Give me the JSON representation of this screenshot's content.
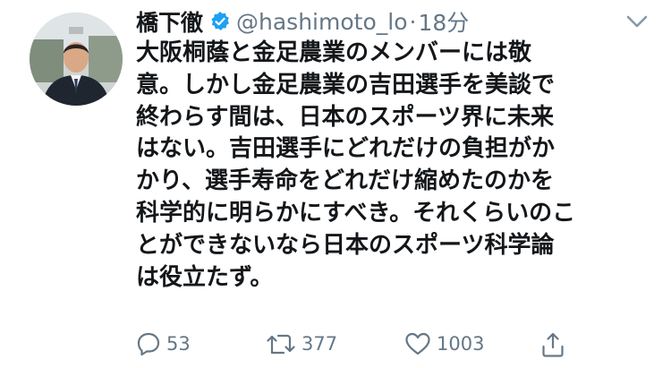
{
  "tweet": {
    "display_name": "橋下徹",
    "handle": "@hashimoto_lo",
    "separator": "·",
    "timestamp": "18分",
    "body_lines": [
      "大阪桐蔭と金足農業のメンバーには敬",
      "意。しかし金足農業の吉田選手を美談で",
      "終わらす間は、日本のスポーツ界に未来",
      "はない。吉田選手にどれだけの負担がか",
      "かり、選手寿命をどれだけ縮めたのかを",
      "科学的に明らかにすべき。それくらいのこ",
      "とができないなら日本のスポーツ科学論",
      "は役立たず。"
    ]
  },
  "actions": {
    "reply": {
      "icon": "reply-icon",
      "count": "53"
    },
    "retweet": {
      "icon": "retweet-icon",
      "count": "377"
    },
    "like": {
      "icon": "heart-icon",
      "count": "1003"
    },
    "share": {
      "icon": "share-icon"
    }
  },
  "colors": {
    "text": "#14171a",
    "secondary": "#657786",
    "verified": "#1da1f2",
    "background": "#ffffff"
  }
}
